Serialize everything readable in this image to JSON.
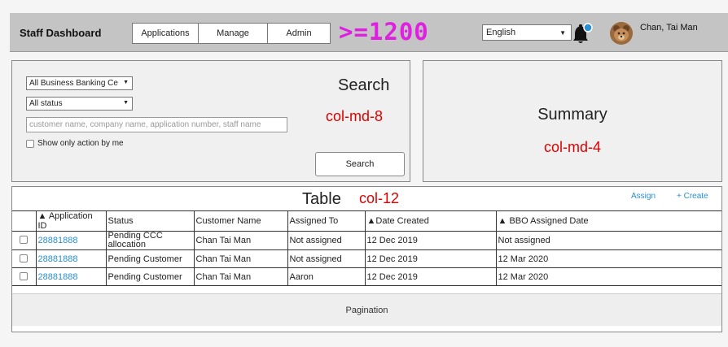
{
  "header": {
    "brand": "Staff Dashboard",
    "nav": [
      "Applications",
      "Manage",
      "Admin"
    ],
    "breakpoint_label": ">=1200",
    "language": "English",
    "user_name": "Chan, Tai Man"
  },
  "search": {
    "business_select": "All Business Banking Ce",
    "status_select": "All status",
    "placeholder": "customer name, company name, application number, staff name",
    "checkbox_label": "Show only action by me",
    "title": "Search",
    "col_label": "col-md-8",
    "button_label": "Search"
  },
  "summary": {
    "title": "Summary",
    "col_label": "col-md-4"
  },
  "table": {
    "title": "Table",
    "col_label": "col-12",
    "assign_label": "Assign",
    "create_label": "+ Create",
    "columns": [
      "▲ Application ID",
      "Status",
      "Customer Name",
      "Assigned To",
      "▲Date Created",
      "▲ BBO Assigned Date"
    ],
    "rows": [
      {
        "id": "28881888",
        "status": "Pending CCC allocation",
        "customer": "Chan Tai Man",
        "assigned": "Not assigned",
        "created": "12 Dec 2019",
        "bbo": "Not assigned"
      },
      {
        "id": "28881888",
        "status": "Pending Customer",
        "customer": "Chan Tai Man",
        "assigned": "Not assigned",
        "created": "12 Dec 2019",
        "bbo": "12 Mar 2020"
      },
      {
        "id": "28881888",
        "status": "Pending Customer",
        "customer": "Chan Tai Man",
        "assigned": "Aaron",
        "created": "12 Dec 2019",
        "bbo": "12 Mar 2020"
      }
    ],
    "pagination": "Pagination"
  },
  "colors": {
    "accent_link": "#2a8fd0",
    "breakpoint": "#e020e0",
    "column_label": "#e00000",
    "header_bg": "#c4c4c4",
    "notification_dot": "#2a8fd0"
  },
  "icons": [
    "bell-icon",
    "notification-dot",
    "avatar",
    "caret-down-icon"
  ]
}
